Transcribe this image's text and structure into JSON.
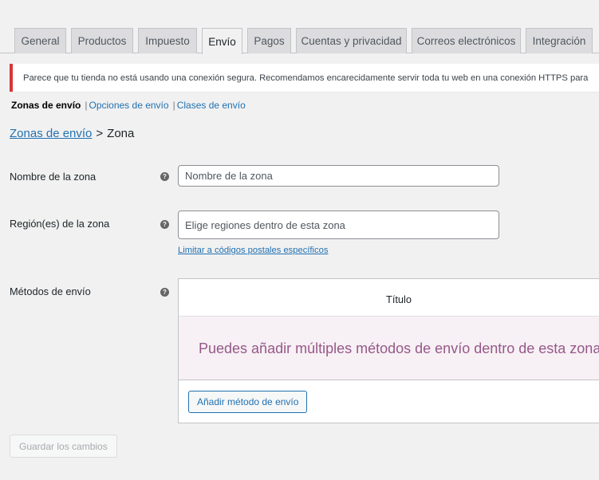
{
  "tabs": [
    {
      "label": "General"
    },
    {
      "label": "Productos"
    },
    {
      "label": "Impuesto"
    },
    {
      "label": "Envío",
      "active": true
    },
    {
      "label": "Pagos"
    },
    {
      "label": "Cuentas y privacidad"
    },
    {
      "label": "Correos electrónicos"
    },
    {
      "label": "Integración"
    }
  ],
  "notice": {
    "text": "Parece que tu tienda no está usando una conexión segura. Recomendamos encarecidamente servir toda tu web en una conexión HTTPS para"
  },
  "subnav": {
    "current": "Zonas de envío",
    "sep": "|",
    "options_link": "Opciones de envío",
    "classes_link": "Clases de envío"
  },
  "breadcrumb": {
    "parent": "Zonas de envío",
    "separator": ">",
    "current": "Zona"
  },
  "form": {
    "zone_name": {
      "label": "Nombre de la zona",
      "placeholder": "Nombre de la zona",
      "value": ""
    },
    "zone_regions": {
      "label": "Región(es) de la zona",
      "placeholder": "Elige regiones dentro de esta zona",
      "value": "",
      "limit_link": "Limitar a códigos postales específicos"
    },
    "methods": {
      "label": "Métodos de envío",
      "column_title": "Título",
      "empty_message": "Puedes añadir múltiples métodos de envío dentro de esta zona",
      "add_button": "Añadir método de envío"
    },
    "help_icon": "?"
  },
  "save_button": "Guardar los cambios",
  "colors": {
    "link": "#2271b1",
    "notice_border": "#d63638",
    "empty_bg": "#f7f0f4",
    "empty_text": "#96588a"
  }
}
